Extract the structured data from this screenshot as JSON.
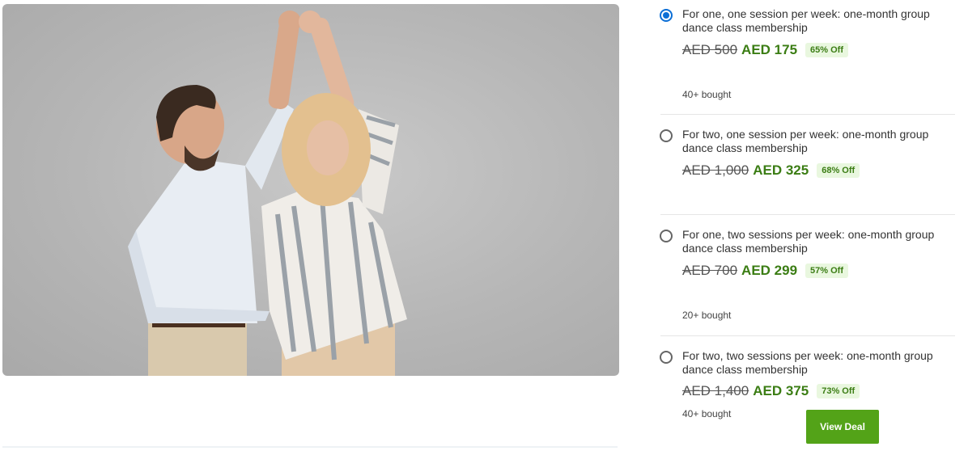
{
  "options": [
    {
      "title": "For one, one session per week: one-month group dance class membership",
      "old_price": "AED 500",
      "new_price": "AED 175",
      "discount": "65% Off",
      "bought": "40+ bought",
      "selected": true
    },
    {
      "title": "For two, one session per week: one-month group dance class membership",
      "old_price": "AED 1,000",
      "new_price": "AED 325",
      "discount": "68% Off",
      "bought": "",
      "selected": false
    },
    {
      "title": "For one, two sessions per week: one-month group dance class membership",
      "old_price": "AED 700",
      "new_price": "AED 299",
      "discount": "57% Off",
      "bought": "20+ bought",
      "selected": false
    },
    {
      "title": "For two, two sessions per week: one-month group dance class membership",
      "old_price": "AED 1,400",
      "new_price": "AED 375",
      "discount": "73% Off",
      "bought": "40+ bought",
      "selected": false
    }
  ],
  "cta": {
    "label": "View Deal"
  },
  "colors": {
    "accent_green": "#3b7d14",
    "button_green": "#53a318",
    "radio_blue": "#0c6fd6",
    "discount_bg": "#e9f7df"
  }
}
